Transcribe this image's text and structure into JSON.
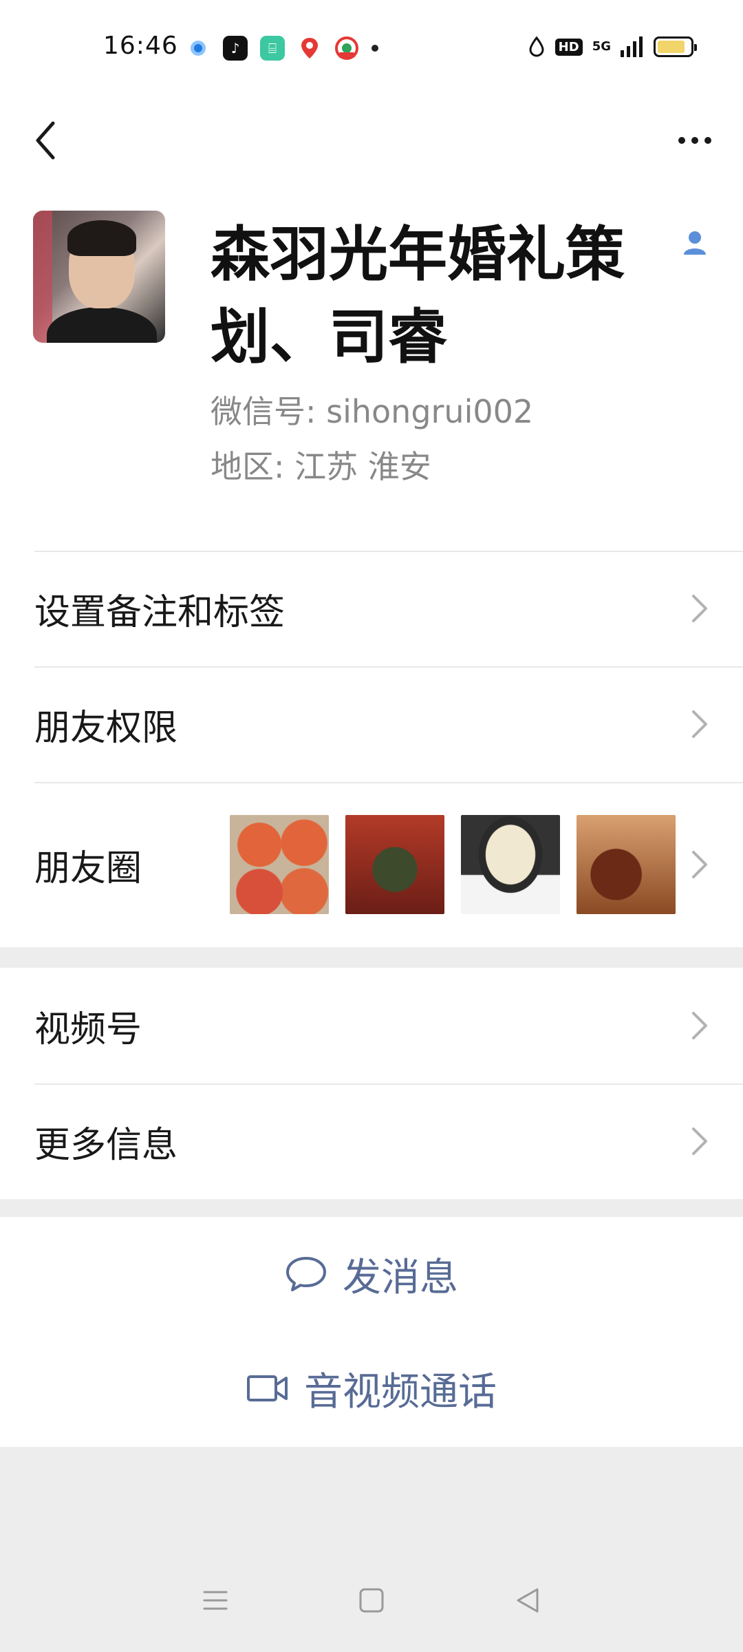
{
  "status_bar": {
    "time": "16:46",
    "network": "5G",
    "hd_badge": "HD",
    "app_icons": [
      "browser-icon",
      "tiktok-icon",
      "store-icon",
      "map-pin-icon",
      "news-icon"
    ],
    "battery_level": 0.85
  },
  "profile": {
    "name": "森羽光年婚礼策划、司睿",
    "wechat_id_label": "微信号: sihongrui002",
    "region_label": "地区: 江苏  淮安"
  },
  "menu": {
    "set_remark": "设置备注和标签",
    "friend_permissions": "朋友权限",
    "moments": "朋友圈",
    "channels": "视频号",
    "more_info": "更多信息"
  },
  "actions": {
    "send_message": "发消息",
    "video_call": "音视频通话"
  },
  "colors": {
    "link_blue": "#576b95",
    "background": "#ededed"
  }
}
